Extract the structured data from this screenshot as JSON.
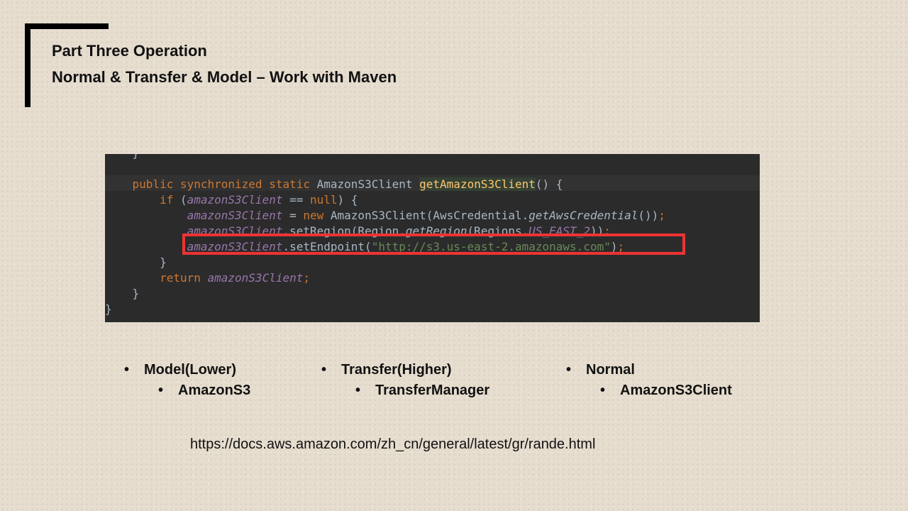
{
  "slide": {
    "title_line1": "Part Three Operation",
    "title_line2": "Normal & Transfer & Model – Work with Maven"
  },
  "code": {
    "line0": "    }",
    "line1": {
      "indent": "    ",
      "kw1": "public",
      "kw2": "synchronized",
      "kw3": "static",
      "type": "AmazonS3Client",
      "method": "getAmazonS3Client",
      "tail": "() {"
    },
    "line2": {
      "indent": "        ",
      "kw": "if",
      "open": " (",
      "field": "amazonS3Client",
      "op": " == ",
      "null": "null",
      "tail": ") {"
    },
    "line3": {
      "indent": "            ",
      "field": "amazonS3Client",
      "eq": " = ",
      "kw": "new",
      "rest1": " AmazonS3Client(AwsCredential.",
      "static_call": "getAwsCredential",
      "rest2": "())",
      "semi": ";"
    },
    "line4": {
      "indent": "            ",
      "field": "amazonS3Client",
      "rest1": ".setRegion(Region.",
      "static_call": "getRegion",
      "rest2": "(Regions.",
      "const": "US_EAST_2",
      "rest3": "))",
      "semi": ";"
    },
    "line5": {
      "indent": "            ",
      "field": "amazonS3Client",
      "rest1": ".setEndpoint(",
      "string": "\"http://s3.us-east-2.amazonaws.com\"",
      "rest2": ")",
      "semi": ";"
    },
    "line6": "        }",
    "line7": {
      "indent": "        ",
      "kw": "return",
      "field": "amazonS3Client",
      "semi": ";"
    },
    "line8": "    }",
    "line9": "}"
  },
  "columns": [
    {
      "heading": "Model(Lower)",
      "item": "AmazonS3"
    },
    {
      "heading": "Transfer(Higher)",
      "item": "TransferManager"
    },
    {
      "heading": "Normal",
      "item": "AmazonS3Client"
    }
  ],
  "bullet_char": "•",
  "link": "https://docs.aws.amazon.com/zh_cn/general/latest/gr/rande.html"
}
